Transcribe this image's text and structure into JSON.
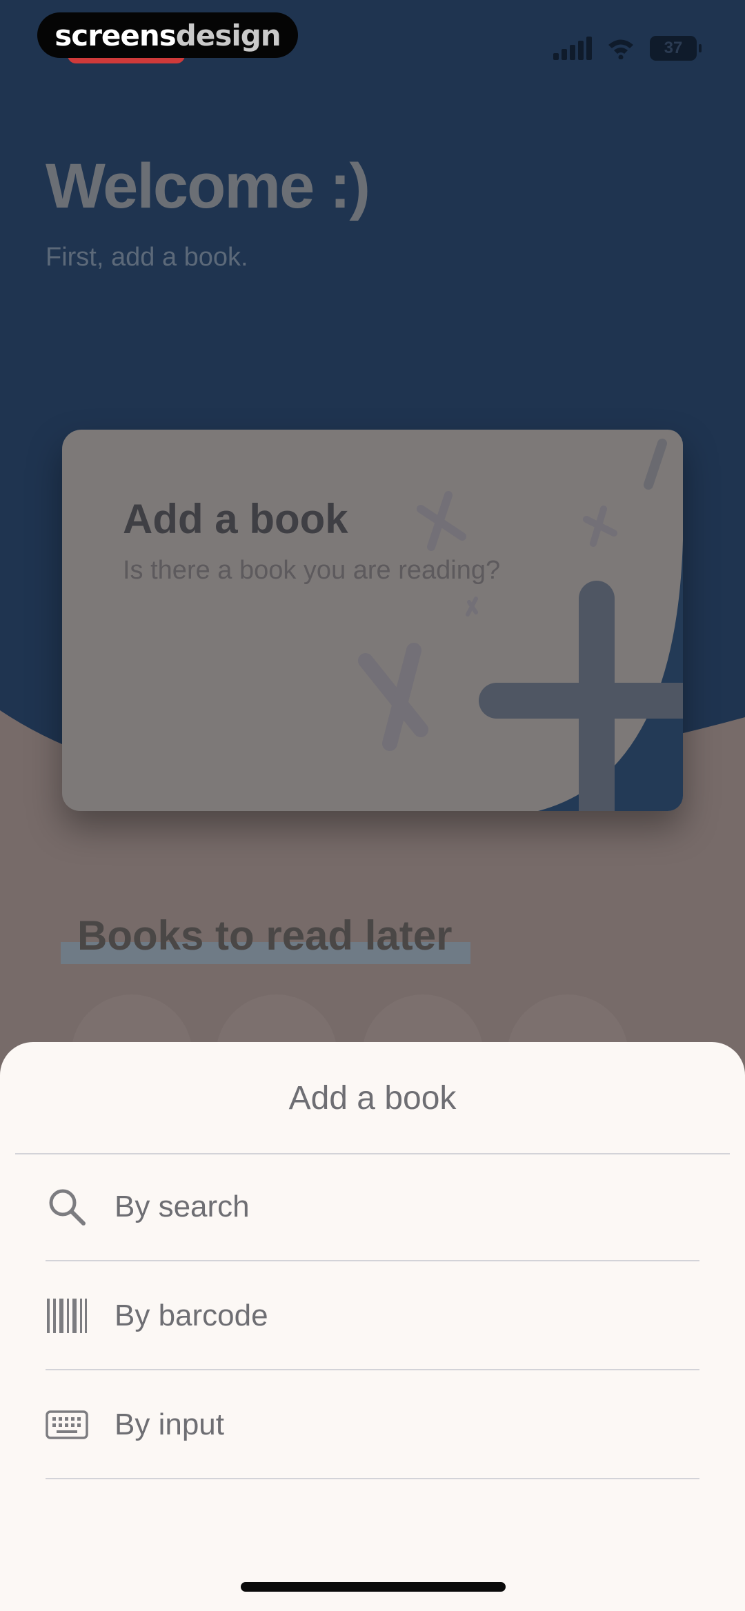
{
  "status_bar": {
    "brand_part1": "screens",
    "brand_part2": "design",
    "battery_level": "37"
  },
  "welcome": {
    "title": "Welcome :)",
    "subtitle": "First, add a book."
  },
  "add_card": {
    "title": "Add a book",
    "subtitle": "Is there a book you are reading?"
  },
  "later_section": {
    "title": "Books to read later"
  },
  "sheet": {
    "title": "Add a book",
    "options": [
      {
        "label": "By search",
        "icon": "search-icon"
      },
      {
        "label": "By barcode",
        "icon": "barcode-icon"
      },
      {
        "label": "By input",
        "icon": "keyboard-icon"
      }
    ]
  },
  "colors": {
    "hero_background": "#1f3450",
    "page_background": "#776b69",
    "sheet_background": "#fcf8f5",
    "sheet_text": "#6e6e73"
  }
}
